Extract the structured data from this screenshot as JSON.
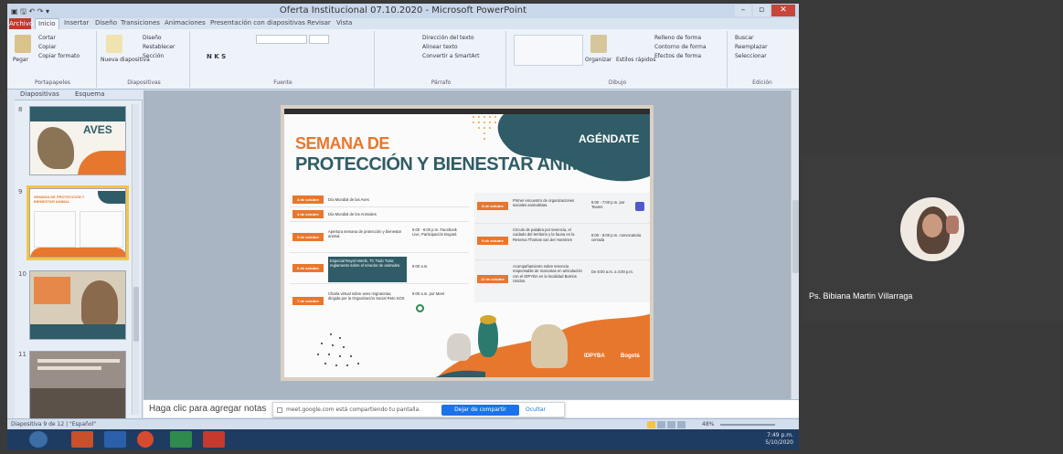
{
  "window": {
    "title": "Oferta Institucional 07.10.2020 - Microsoft PowerPoint",
    "quick_access": "▣ 🖫 ↶ ↷ ▾",
    "min": "–",
    "max": "▫",
    "close": "✕"
  },
  "ribbon": {
    "tabs": [
      "Archivo",
      "Inicio",
      "Insertar",
      "Diseño",
      "Transiciones",
      "Animaciones",
      "Presentación con diapositivas",
      "Revisar",
      "Vista"
    ],
    "groups": [
      "Portapapeles",
      "Diapositivas",
      "Fuente",
      "Párrafo",
      "Dibujo",
      "Edición"
    ],
    "clipboard": {
      "paste": "Pegar",
      "cut": "Cortar",
      "copy": "Copiar",
      "format": "Copiar formato"
    },
    "slides": {
      "new": "Nueva diapositiva",
      "layout": "Diseño",
      "reset": "Restablecer",
      "section": "Sección"
    },
    "paragraph": {
      "dir": "Dirección del texto",
      "align": "Alinear texto",
      "smartart": "Convertir a SmartArt"
    },
    "drawing": {
      "arrange": "Organizar",
      "styles": "Estilos rápidos",
      "fill": "Relleno de forma",
      "outline": "Contorno de forma",
      "effects": "Efectos de forma"
    },
    "editing": {
      "find": "Buscar",
      "replace": "Reemplazar",
      "select": "Seleccionar"
    }
  },
  "panel": {
    "tab_slides": "Diapositivas",
    "tab_outline": "Esquema"
  },
  "thumbnails": [
    {
      "num": "8",
      "text": "AVES"
    },
    {
      "num": "9",
      "text": "SEMANA DE PROTECCIÓN Y BIENESTAR ANIMAL"
    },
    {
      "num": "10",
      "text": ""
    },
    {
      "num": "11",
      "text": ""
    }
  ],
  "slide": {
    "title_line1": "SEMANA DE",
    "title_line2": "PROTECCIÓN Y BIENESTAR ANIMAL",
    "agendate": "AGÉNDATE",
    "footer_logos": [
      "IDPYBA",
      "Bogotá"
    ],
    "left_schedule": [
      {
        "date": "4 de octubre",
        "event": "Día Mundial de las Aves",
        "time": ""
      },
      {
        "date": "4 de octubre",
        "event": "Día Mundial de los Animales",
        "time": ""
      },
      {
        "date": "5 de octubre",
        "event": "Apertura semana de protección y bienestar animal.",
        "time": "5:00 - 6:00 p.m. Facebook Live, Participación Bogotá"
      },
      {
        "date": "6 de octubre",
        "event": "Especial Royal Hotels, TC Todo Tutor, reglamento sobre el tenedor de animales.",
        "time": "9:00 a.m."
      },
      {
        "date": "7 de octubre",
        "event": "Charla virtual sobre aves migratorias, dirigida por la Organización Social Reto SOS",
        "time": "9:00 a.m. por Meet"
      }
    ],
    "right_schedule": [
      {
        "date": "8 de octubre",
        "event": "Primer encuentro de organizaciones sociales animalistas.",
        "time": "5:00 - 7:00 p.m. por Teams"
      },
      {
        "date": "9 de octubre",
        "event": "Circulo de palabra por tenencia, el cuidado del territorio y la fauna en la Reserva Thomas van der Hammen",
        "time": "6:00 - 8:00 p.m. convocatoria cerrada"
      },
      {
        "date": "11 de octubre",
        "event": "Acompañamiento sobre tenencia responsable de mascotas en articulación con el IDPYBA en la localidad Barrios Unidos.",
        "time": "De 8:00 a.m. a 4:00 p.m."
      }
    ]
  },
  "notes": {
    "placeholder": "Haga clic para agregar notas"
  },
  "sharebar": {
    "message": "meet.google.com está compartiendo tu pantalla.",
    "stop": "Dejar de compartir",
    "hide": "Ocultar"
  },
  "statusbar": {
    "slide_info": "Diapositiva 9 de 12  |  \"Español\"",
    "zoom": "48%"
  },
  "taskbar": {
    "clock": "7:49 p.m.\n5/10/2020"
  },
  "participant": {
    "name": "Ps. Bibiana Martin Villarraga"
  },
  "colors": {
    "orange": "#e8772e",
    "teal": "#2f5c66",
    "meet_blue": "#1a73e8"
  }
}
